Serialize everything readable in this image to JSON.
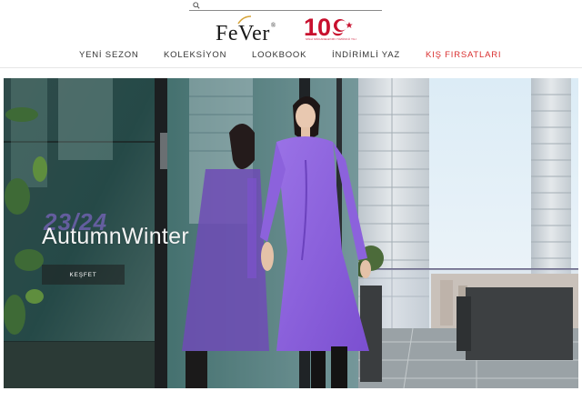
{
  "search": {
    "placeholder": "",
    "icon": "search-icon"
  },
  "brand": {
    "logo_text": "FeVer",
    "logo_reg": "®",
    "centennial_mark": "100",
    "centennial_caption": "MİLLİ MÜCADELE'NİN YÜZÜNCÜ YILI",
    "accent_color": "#c8102e"
  },
  "nav": {
    "items": [
      {
        "label": "YENİ SEZON"
      },
      {
        "label": "KOLEKSİYON"
      },
      {
        "label": "LOOKBOOK"
      },
      {
        "label": "İNDİRİMLİ YAZ"
      },
      {
        "label": "KIŞ FIRSATLARI"
      }
    ],
    "highlight_color": "#d92e2e"
  },
  "hero": {
    "bg_numbers": "23/24",
    "title": "AutumnWinter",
    "cta_label": "KEŞFET",
    "dress_color": "#8a5fd6"
  }
}
